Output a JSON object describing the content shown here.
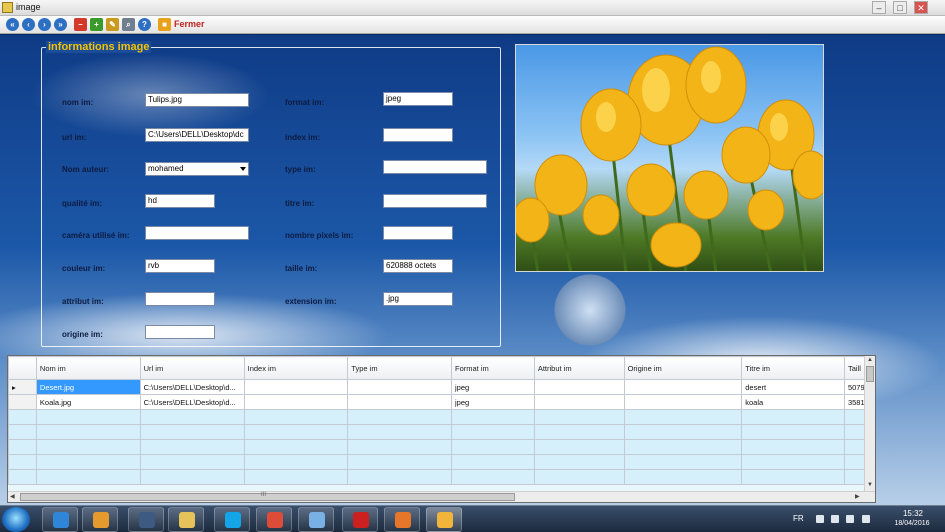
{
  "window": {
    "title": "image",
    "controls": [
      "–",
      "□",
      "✕"
    ]
  },
  "toolbar": {
    "buttons": [
      {
        "icon": "first-record-icon",
        "glyph": "«",
        "color": "#2d6fc2"
      },
      {
        "icon": "previous-record-icon",
        "glyph": "‹",
        "color": "#2d6fc2"
      },
      {
        "icon": "next-record-icon",
        "glyph": "›",
        "color": "#2d6fc2"
      },
      {
        "icon": "last-record-icon",
        "glyph": "»",
        "color": "#2d6fc2"
      },
      {
        "icon": "delete-icon",
        "glyph": "–",
        "color": "#d23a2a"
      },
      {
        "icon": "add-icon",
        "glyph": "+",
        "color": "#3a9a2a"
      },
      {
        "icon": "edit-pencil-icon",
        "glyph": "✎",
        "color": "#c99a1e"
      },
      {
        "icon": "search-icon",
        "glyph": "⌕",
        "color": "#6f7f8f"
      },
      {
        "icon": "help-icon",
        "glyph": "?",
        "color": "#2d6fc2"
      },
      {
        "icon": "close-app-icon",
        "glyph": "■",
        "color": "#e8a11a"
      }
    ],
    "fermer_label": "Fermer"
  },
  "form": {
    "group_title": "informations image",
    "nom": {
      "label": "nom im:",
      "value": "Tulips.jpg"
    },
    "url": {
      "label": "url im:",
      "value": "C:\\Users\\DELL\\Desktop\\dc"
    },
    "auteur": {
      "label": "Nom auteur:",
      "value": "mohamed"
    },
    "qualite": {
      "label": "qualité im:",
      "value": "hd"
    },
    "camera": {
      "label": "caméra utilisé im:",
      "value": ""
    },
    "couleur": {
      "label": "couleur im:",
      "value": "rvb"
    },
    "attribut": {
      "label": "attribut im:",
      "value": ""
    },
    "origine": {
      "label": "origine im:",
      "value": ""
    },
    "format": {
      "label": "format im:",
      "value": "jpeg"
    },
    "index": {
      "label": "index im:",
      "value": ""
    },
    "type": {
      "label": "type im:",
      "value": ""
    },
    "titre": {
      "label": "titre im:",
      "value": ""
    },
    "pixels": {
      "label": "nombre pixels im:",
      "value": ""
    },
    "taille": {
      "label": "taille im:",
      "value": "620888 octets"
    },
    "extension": {
      "label": "extension im:",
      "value": ".jpg"
    }
  },
  "grid": {
    "columns": [
      "Nom im",
      "Url im",
      "Index im",
      "Type im",
      "Format im",
      "Attribut im",
      "Origine im",
      "Titre im",
      "Taill"
    ],
    "rows": [
      [
        "Desert.jpg",
        "C:\\Users\\DELL\\Desktop\\d...",
        "",
        "",
        "jpeg",
        "",
        "",
        "desert",
        "5079"
      ],
      [
        "Koala.jpg",
        "C:\\Users\\DELL\\Desktop\\d...",
        "",
        "",
        "jpeg",
        "",
        "",
        "koala",
        "3581"
      ]
    ],
    "current_row_marker": "▸",
    "hscroll_grip": "III"
  },
  "taskbar": {
    "apps": [
      {
        "name": "internet-explorer",
        "color": "#2f86d8"
      },
      {
        "name": "media-player",
        "color": "#e59a2e"
      },
      {
        "name": "monitor-app",
        "color": "#3c5a82"
      },
      {
        "name": "file-explorer",
        "color": "#e6c25a"
      },
      {
        "name": "skype",
        "color": "#14a5e8"
      },
      {
        "name": "chrome",
        "color": "#dd4b39"
      },
      {
        "name": "notepad-app",
        "color": "#7ab1e4"
      },
      {
        "name": "opera",
        "color": "#cc1f1f"
      },
      {
        "name": "media-center",
        "color": "#e6762a"
      },
      {
        "name": "visual-studio-app",
        "color": "#f0b53a"
      }
    ],
    "language": "FR",
    "time": "15:32",
    "date": "18/04/2016"
  }
}
